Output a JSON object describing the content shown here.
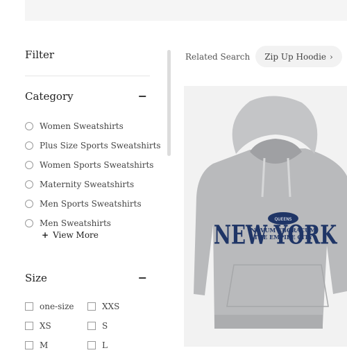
{
  "filter": {
    "title": "Filter"
  },
  "category": {
    "title": "Category",
    "collapse_icon": "minus-icon",
    "items": [
      {
        "label": "Women Sweatshirts"
      },
      {
        "label": "Plus Size Sports Sweatshirts"
      },
      {
        "label": "Women Sports Sweatshirts"
      },
      {
        "label": "Maternity Sweatshirts"
      },
      {
        "label": "Men Sports Sweatshirts"
      },
      {
        "label": "Men Sweatshirts"
      }
    ],
    "view_more": "View More",
    "view_more_icon": "plus-icon"
  },
  "size": {
    "title": "Size",
    "collapse_icon": "minus-icon",
    "items": [
      {
        "label": "one-size"
      },
      {
        "label": "XXS"
      },
      {
        "label": "XS"
      },
      {
        "label": "S"
      },
      {
        "label": "M"
      },
      {
        "label": "L"
      }
    ]
  },
  "related": {
    "label": "Related Search",
    "chips": [
      {
        "label": "Zip Up Hoodie",
        "icon": "chevron-right-icon"
      }
    ]
  },
  "product": {
    "image": "gray-hoodie-photo",
    "print": {
      "headline": "NEW YORK",
      "badge": "QUEENS",
      "line1": "NOVUM EBORACUM",
      "line2": "THE EMPIRE CITY"
    },
    "colors": {
      "garment": "#b9babc",
      "print": "#1f3566"
    }
  }
}
